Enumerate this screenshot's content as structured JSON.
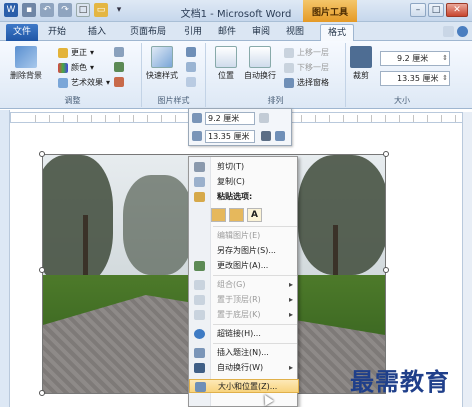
{
  "titlebar": {
    "title": "文档1 - Microsoft Word",
    "picture_tools": "图片工具"
  },
  "tabs": [
    {
      "label": "文件"
    },
    {
      "label": "开始"
    },
    {
      "label": "插入"
    },
    {
      "label": "页面布局"
    },
    {
      "label": "引用"
    },
    {
      "label": "邮件"
    },
    {
      "label": "审阅"
    },
    {
      "label": "视图"
    },
    {
      "label": "格式"
    }
  ],
  "ribbon": {
    "remove_bg": "删除背景",
    "corrections": "更正",
    "color": "颜色",
    "artistic": "艺术效果",
    "adjust_label": "调整",
    "quick_styles": "快速样式",
    "picture_styles_label": "图片样式",
    "position": "位置",
    "wrap_text": "自动换行",
    "bring_forward": "上移一层",
    "send_backward": "下移一层",
    "selection_pane": "选择窗格",
    "arrange_label": "排列",
    "crop": "裁剪",
    "height_value": "9.2 厘米",
    "width_value": "13.35 厘米",
    "size_label": "大小"
  },
  "mini_toolbar": {
    "height_value": "9.2 厘米",
    "width_value": "13.35 厘米"
  },
  "context_menu": {
    "items": [
      {
        "label": "剪切(T)"
      },
      {
        "label": "复制(C)"
      },
      {
        "label": "粘贴选项:"
      },
      {
        "label": "编辑图片(E)"
      },
      {
        "label": "另存为图片(S)..."
      },
      {
        "label": "更改图片(A)..."
      },
      {
        "label": "组合(G)"
      },
      {
        "label": "置于顶层(R)"
      },
      {
        "label": "置于底层(K)"
      },
      {
        "label": "超链接(H)..."
      },
      {
        "label": "插入题注(N)..."
      },
      {
        "label": "自动换行(W)"
      },
      {
        "label": "大小和位置(Z)..."
      }
    ],
    "paste_option_text": "A"
  },
  "watermark": "最需教育"
}
